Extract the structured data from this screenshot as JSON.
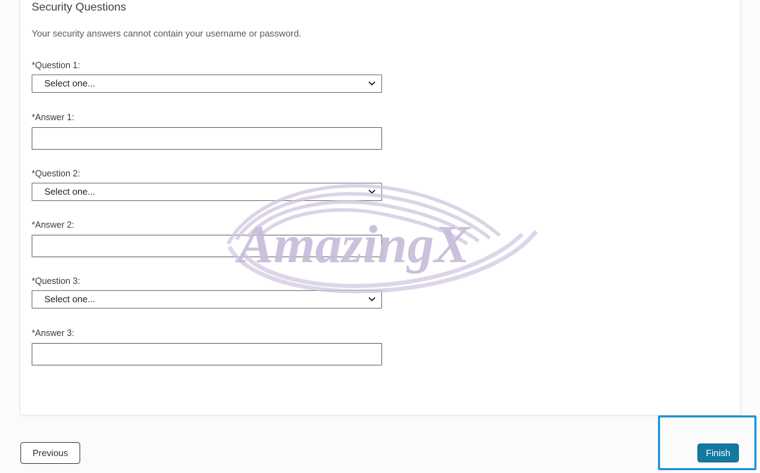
{
  "card": {
    "title": "Security Questions",
    "description": "Your security answers cannot contain your username or password."
  },
  "form": {
    "fields": [
      {
        "label": "*Question 1:",
        "type": "select",
        "value": "Select one...",
        "name": "question-1"
      },
      {
        "label": "*Answer 1:",
        "type": "text",
        "value": "",
        "placeholder": "",
        "name": "answer-1"
      },
      {
        "label": "*Question 2:",
        "type": "select",
        "value": "Select one...",
        "name": "question-2"
      },
      {
        "label": "*Answer 2:",
        "type": "text",
        "value": "",
        "placeholder": "",
        "name": "answer-2"
      },
      {
        "label": "*Question 3:",
        "type": "select",
        "value": "Select one...",
        "name": "question-3"
      },
      {
        "label": "*Answer 3:",
        "type": "text",
        "value": "",
        "placeholder": "",
        "name": "answer-3"
      }
    ],
    "select_icon": "chevron-down-icon"
  },
  "footer": {
    "previous_label": "Previous",
    "finish_label": "Finish"
  },
  "watermark": {
    "text": "AmazingX",
    "color": "#c9bedd"
  },
  "colors": {
    "page_background": "#fbfbfc",
    "card_background": "#ffffff",
    "finish_button": "#1279a0",
    "highlight_border": "#2196d6",
    "control_border": "#767676"
  }
}
